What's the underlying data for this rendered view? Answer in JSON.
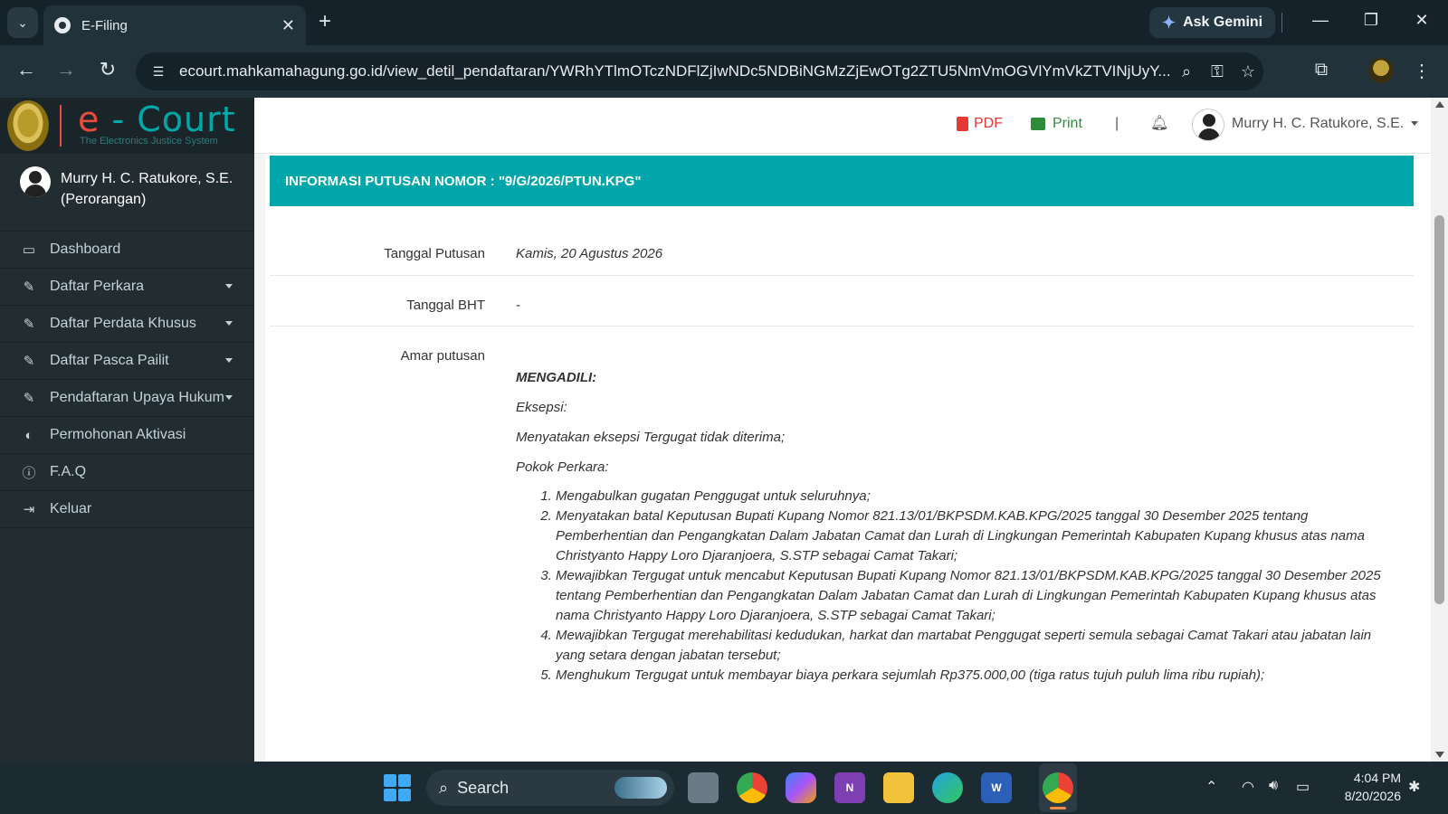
{
  "browser": {
    "tab_title": "E-Filing",
    "new_tab": "+",
    "ask_gemini": "Ask Gemini",
    "url": "ecourt.mahkamahagung.go.id/view_detil_pendaftaran/YWRhYTlmOTczNDFlZjIwNDc5NDBiNGMzZjEwOTg2ZTU5NmVmOGVlYmVkZTVINjUyY..."
  },
  "sidebar": {
    "logo_e": "e",
    "logo_court": " - Court",
    "logo_sub": "The Electronics Justice System",
    "user_name": "Murry H. C. Ratukore, S.E.",
    "user_type": "(Perorangan)",
    "items": [
      {
        "label": "Dashboard",
        "icon": "laptop-icon",
        "glyph": "▭",
        "caret": false
      },
      {
        "label": "Daftar Perkara",
        "icon": "edit-icon",
        "glyph": "✎",
        "caret": true
      },
      {
        "label": "Daftar Perdata Khusus",
        "icon": "edit-icon",
        "glyph": "✎",
        "caret": true
      },
      {
        "label": "Daftar Pasca Pailit",
        "icon": "edit-icon",
        "glyph": "✎",
        "caret": true
      },
      {
        "label": "Pendaftaran Upaya Hukum",
        "icon": "edit-icon",
        "glyph": "✎",
        "caret": true
      },
      {
        "label": "Permohonan Aktivasi",
        "icon": "toggle-icon",
        "glyph": "◐",
        "caret": false
      },
      {
        "label": "F.A.Q",
        "icon": "info-icon",
        "glyph": "ⓘ",
        "caret": false
      },
      {
        "label": "Keluar",
        "icon": "sign-out-icon",
        "glyph": "⇥",
        "caret": false
      }
    ]
  },
  "topnav": {
    "pdf": "PDF",
    "print": "Print",
    "pipe": "|",
    "user": "Murry H. C. Ratukore, S.E."
  },
  "main": {
    "header": "INFORMASI PUTUSAN NOMOR : \"9/G/2026/PTUN.KPG\"",
    "tanggal_putusan_label": "Tanggal Putusan",
    "tanggal_putusan_value": "Kamis, 20 Agustus 2026",
    "tanggal_bht_label": "Tanggal BHT",
    "tanggal_bht_value": "-",
    "amar_label": "Amar putusan",
    "mengadili": "MENGADILI:",
    "eksepsi": "Eksepsi:",
    "eksepsi_text": "Menyatakan eksepsi Tergugat tidak diterima;",
    "pokok": "Pokok Perkara:",
    "points": [
      "Mengabulkan gugatan Penggugat untuk seluruhnya;",
      "Menyatakan batal Keputusan Bupati Kupang Nomor 821.13/01/BKPSDM.KAB.KPG/2025 tanggal 30 Desember 2025 tentang Pemberhentian dan Pengangkatan Dalam Jabatan Camat dan Lurah di Lingkungan Pemerintah Kabupaten Kupang khusus atas nama Christyanto Happy Loro Djaranjoera, S.STP sebagai Camat Takari;",
      "Mewajibkan Tergugat untuk mencabut Keputusan Bupati Kupang Nomor 821.13/01/BKPSDM.KAB.KPG/2025 tanggal 30 Desember 2025 tentang Pemberhentian dan Pengangkatan Dalam Jabatan Camat dan Lurah di Lingkungan Pemerintah Kabupaten Kupang khusus atas nama Christyanto Happy Loro Djaranjoera, S.STP sebagai Camat Takari;",
      "Mewajibkan Tergugat merehabilitasi kedudukan, harkat dan martabat Penggugat seperti semula sebagai Camat Takari atau jabatan lain yang setara dengan jabatan tersebut;",
      "Menghukum Tergugat untuk membayar biaya perkara sejumlah Rp375.000,00 (tiga ratus tujuh puluh lima ribu rupiah);"
    ]
  },
  "taskbar": {
    "search": "Search",
    "time": "4:04 PM",
    "date": "8/20/2026"
  }
}
